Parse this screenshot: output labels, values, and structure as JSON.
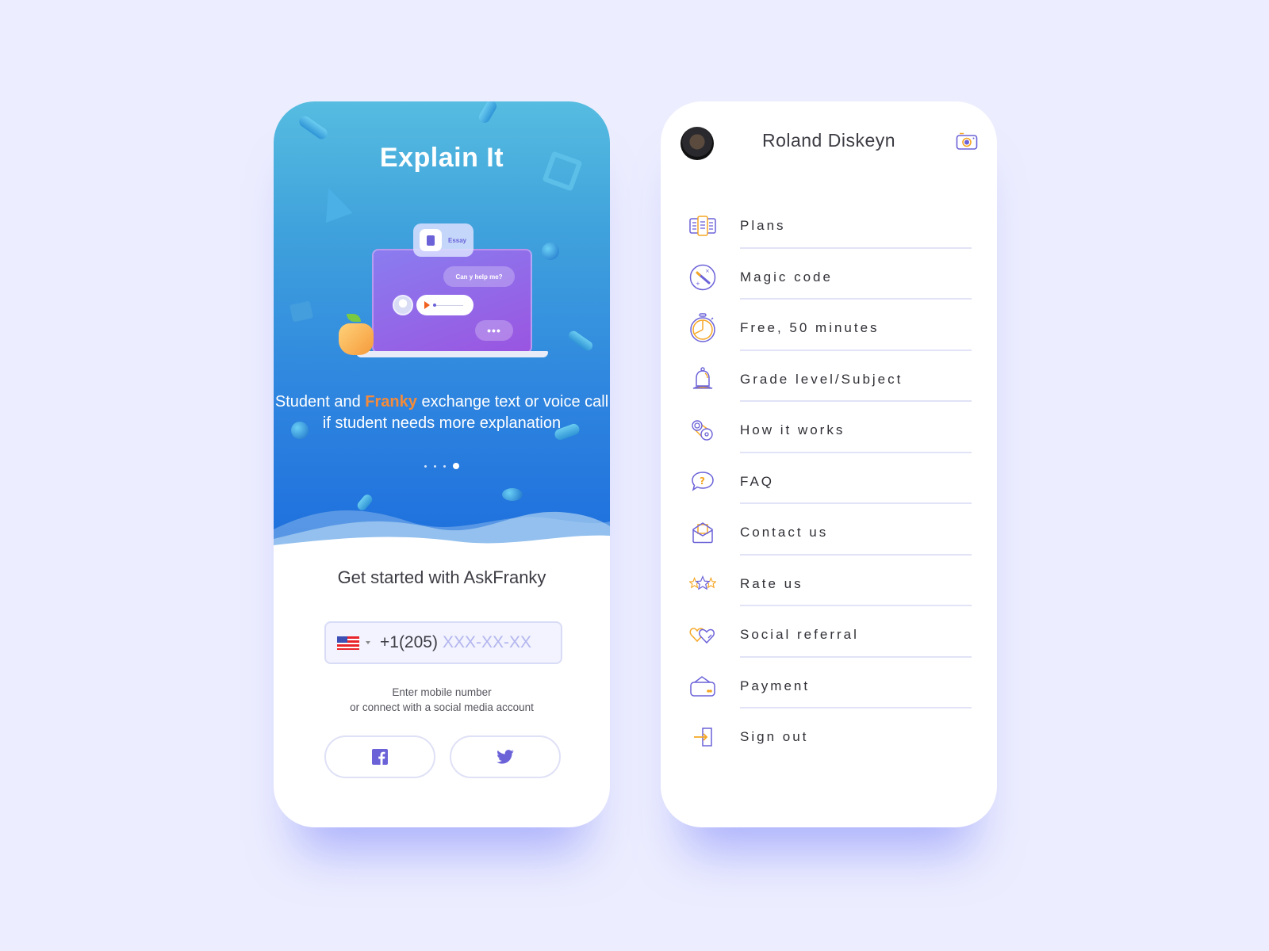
{
  "colors": {
    "background": "#ecedfe",
    "accent_orange": "#f58b3a",
    "accent_purple": "#6b62d8",
    "divider": "#e1e3f6"
  },
  "onboarding": {
    "title": "Explain It",
    "illustration": {
      "essay_chip": "Essay",
      "question_bubble": "Can y help me?",
      "typing_indicator": "•••"
    },
    "description_before": "Student and ",
    "description_highlight": "Franky",
    "description_after": " exchange text or voice call if student needs more explanation",
    "pager": {
      "total": 4,
      "active_index": 3
    },
    "signup_title": "Get started with AskFranky",
    "phone": {
      "country_flag": "us-flag",
      "prefix": "+1(205)",
      "value": "",
      "placeholder": "XXX-XX-XX"
    },
    "hint_line1": "Enter mobile number",
    "hint_line2": "or connect with a social media account",
    "social_buttons": [
      {
        "name": "facebook",
        "icon": "facebook-icon"
      },
      {
        "name": "twitter",
        "icon": "twitter-icon"
      }
    ]
  },
  "menu_screen": {
    "user_name": "Roland Diskeyn",
    "camera_icon": "camera-icon",
    "items": [
      {
        "label": "Plans",
        "icon": "plans-icon"
      },
      {
        "label": "Magic code",
        "icon": "magic-wand-icon"
      },
      {
        "label": "Free, 50 minutes",
        "icon": "stopwatch-icon"
      },
      {
        "label": "Grade level/Subject",
        "icon": "bell-icon"
      },
      {
        "label": "How it works",
        "icon": "gears-icon"
      },
      {
        "label": "FAQ",
        "icon": "question-bubble-icon"
      },
      {
        "label": "Contact us",
        "icon": "envelope-icon"
      },
      {
        "label": "Rate us",
        "icon": "stars-icon"
      },
      {
        "label": "Social referral",
        "icon": "hearts-icon"
      },
      {
        "label": "Payment",
        "icon": "wallet-icon"
      },
      {
        "label": "Sign out",
        "icon": "sign-out-icon"
      }
    ]
  }
}
